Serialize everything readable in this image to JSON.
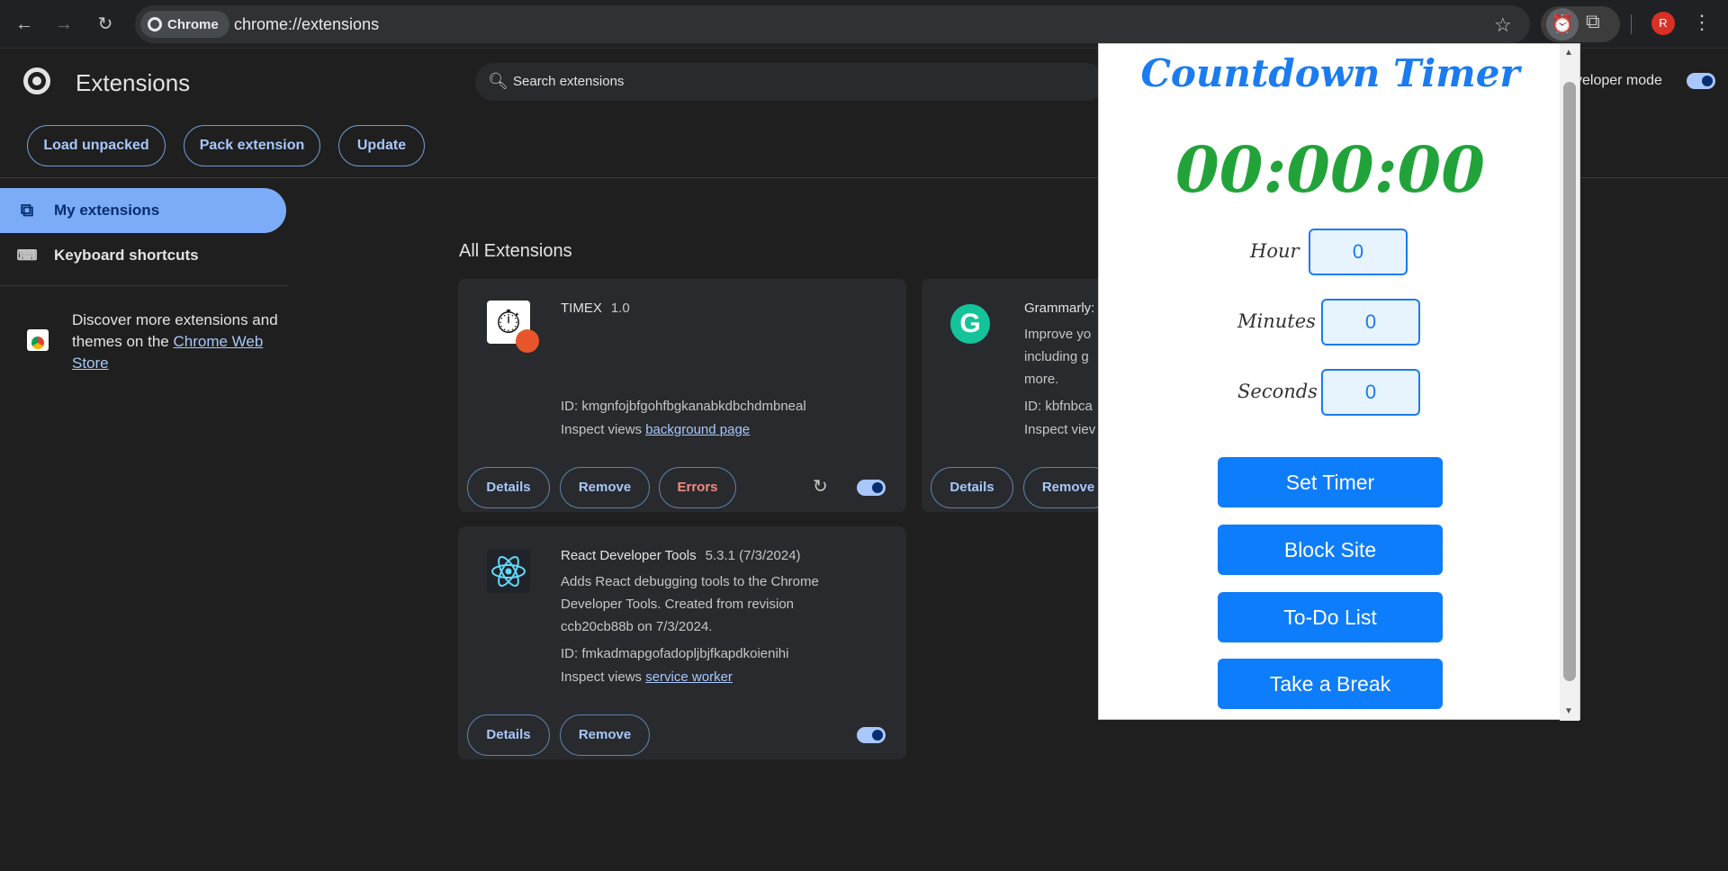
{
  "browser": {
    "chip_label": "Chrome",
    "url": "chrome://extensions",
    "avatar_letter": "R"
  },
  "header": {
    "title": "Extensions",
    "search_placeholder": "Search extensions",
    "dev_mode_label": "veloper mode",
    "buttons": [
      "Load unpacked",
      "Pack extension",
      "Update"
    ]
  },
  "sidebar": {
    "items": [
      {
        "label": "My extensions",
        "icon": "puzzle-icon",
        "active": true
      },
      {
        "label": "Keyboard shortcuts",
        "icon": "keyboard-icon",
        "active": false
      }
    ],
    "discover_text": "Discover more extensions and themes on the ",
    "discover_link": "Chrome Web Store"
  },
  "main": {
    "section_title": "All Extensions",
    "cards": [
      {
        "name": "TIMEX",
        "version": "1.0",
        "id_line": "ID: kmgnfojbfgohfbgkanabkdbchdmbneal",
        "inspect_prefix": "Inspect views ",
        "inspect_link": "background page",
        "buttons": [
          "Details",
          "Remove",
          "Errors"
        ]
      },
      {
        "name": "Grammarly:",
        "desc_lines": [
          "Improve yo",
          "including g",
          "more."
        ],
        "id_line": "ID: kbfnbca",
        "inspect_prefix": "Inspect viev",
        "buttons": [
          "Details",
          "Remove"
        ]
      },
      {
        "name": "React Developer Tools",
        "version": "5.3.1 (7/3/2024)",
        "desc_lines": [
          "Adds React debugging tools to the Chrome",
          "Developer Tools. Created from revision",
          "ccb20cb88b on 7/3/2024."
        ],
        "id_line": "ID: fmkadmapgofadopljbjfkapdkoienihi",
        "inspect_prefix": "Inspect views ",
        "inspect_link": "service worker",
        "buttons": [
          "Details",
          "Remove"
        ]
      }
    ]
  },
  "popup": {
    "title": "Countdown Timer",
    "clock": "00:00:00",
    "fields": [
      {
        "label": "Hour",
        "value": "0"
      },
      {
        "label": "Minutes",
        "value": "0"
      },
      {
        "label": "Seconds",
        "value": "0"
      }
    ],
    "buttons": [
      "Set Timer",
      "Block Site",
      "To-Do List",
      "Take a Break"
    ]
  },
  "colors": {
    "accent": "#a8c7fa",
    "popup_title": "#1a7cf0",
    "clock": "#22a33a",
    "popup_button": "#0d7dfb"
  }
}
